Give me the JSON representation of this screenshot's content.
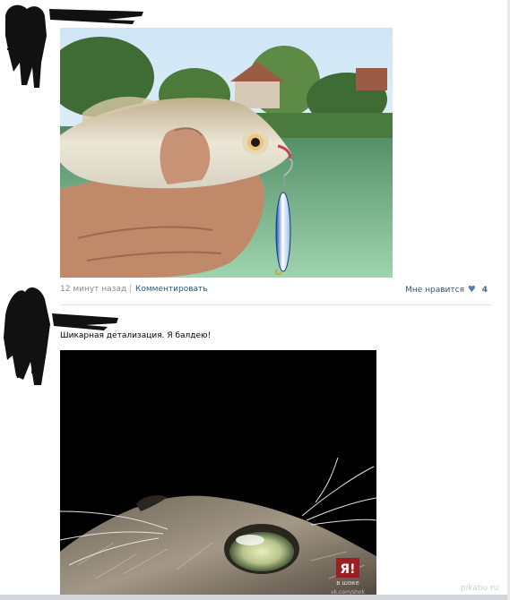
{
  "post1": {
    "time": "12 минут назад",
    "separator": "|",
    "comment_link": "Комментировать",
    "like_label": "Мне нравится",
    "like_count": "4"
  },
  "post2": {
    "text": "Шикарная детализация. Я балдею!",
    "watermark_logo": "Я!",
    "watermark_brand": "в шоке",
    "watermark_site": "vk.com/shok"
  },
  "footer": {
    "site_watermark": "pikabu.ru"
  },
  "icons": {
    "like": "heart-icon"
  },
  "colors": {
    "link": "#2b587a",
    "like_count": "#45688e",
    "meta_gray": "#8a8a8a"
  }
}
